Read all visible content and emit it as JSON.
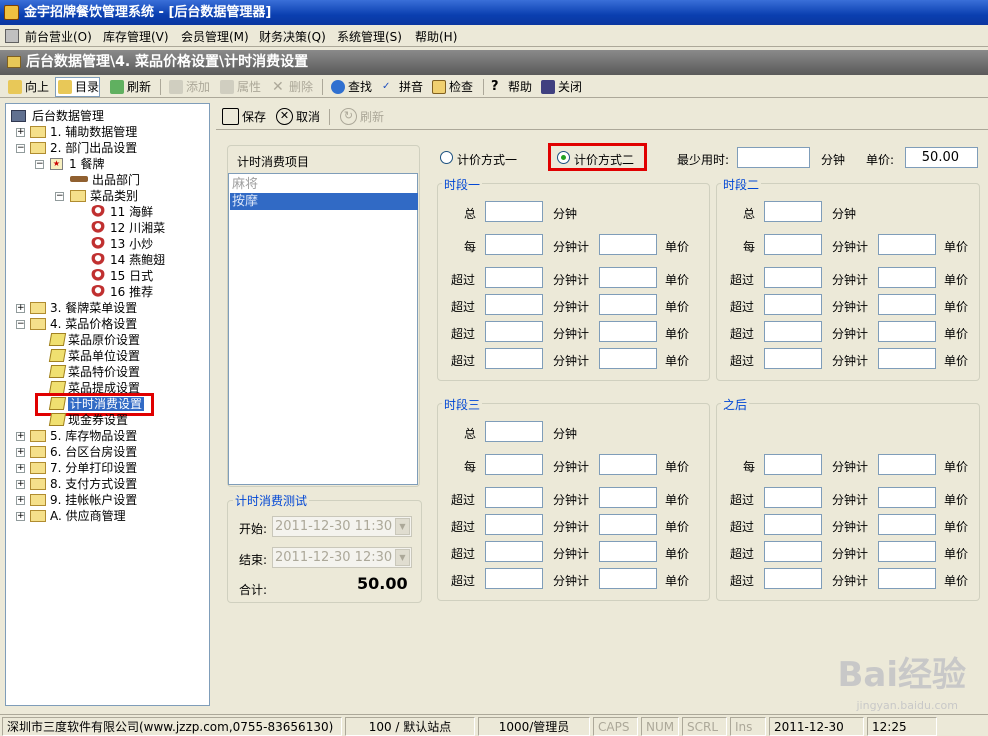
{
  "window": {
    "title": "金宇招牌餐饮管理系统 - [后台数据管理器]"
  },
  "menu": [
    "前台营业(O)",
    "库存管理(V)",
    "会员管理(M)",
    "财务决策(Q)",
    "系统管理(S)",
    "帮助(H)"
  ],
  "path": "后台数据管理\\4. 菜品价格设置\\计时消费设置",
  "toolbar": {
    "up": "向上",
    "dir": "目录",
    "refresh": "刷新",
    "add": "添加",
    "props": "属性",
    "delete": "删除",
    "find": "查找",
    "pinyin": "拼音",
    "check": "检查",
    "help": "帮助",
    "close": "关闭"
  },
  "tree": {
    "root": "后台数据管理",
    "n1": "1. 辅助数据管理",
    "n2": "2. 部门出品设置",
    "n2a": "1 餐牌",
    "n2a1": "出品部门",
    "n2a2": "菜品类别",
    "c11": "11 海鲜",
    "c12": "12 川湘菜",
    "c13": "13 小炒",
    "c14": "14 燕鲍翅",
    "c15": "15 日式",
    "c16": "16 推荐",
    "n3": "3. 餐牌菜单设置",
    "n4": "4. 菜品价格设置",
    "n4a": "菜品原价设置",
    "n4b": "菜品单位设置",
    "n4c": "菜品特价设置",
    "n4d": "菜品提成设置",
    "n4e": "计时消费设置",
    "n4f": "现金券设置",
    "n5": "5. 库存物品设置",
    "n6": "6. 台区台房设置",
    "n7": "7. 分单打印设置",
    "n8": "8. 支付方式设置",
    "n9": "9. 挂帐帐户设置",
    "nA": "A. 供应商管理"
  },
  "rtoolbar": {
    "save": "保存",
    "cancel": "取消",
    "refresh": "刷新"
  },
  "items": {
    "title": "计时消费项目",
    "list": [
      "麻将",
      "按摩"
    ]
  },
  "test": {
    "title": "计时消费测试",
    "start_label": "开始:",
    "start": "2011-12-30 11:30",
    "end_label": "结束:",
    "end": "2011-12-30 12:30",
    "total_label": "合计:",
    "total": "50.00"
  },
  "pricing": {
    "mode1": "计价方式一",
    "mode2": "计价方式二",
    "min_label": "最少用时:",
    "min_unit": "分钟",
    "price_label": "单价:",
    "price": "50.00"
  },
  "periods": {
    "p1": "时段一",
    "p2": "时段二",
    "p3": "时段三",
    "p4": "之后",
    "total": "总",
    "minute": "分钟",
    "each": "每",
    "per_min": "分钟计",
    "unit_price": "单价",
    "over": "超过"
  },
  "status": {
    "company": "深圳市三度软件有限公司(www.jzzp.com,0755-83656130)",
    "station": "100 / 默认站点",
    "user": "1000/管理员",
    "caps": "CAPS",
    "num": "NUM",
    "scrl": "SCRL",
    "ins": "Ins",
    "date": "2011-12-30",
    "time": "12:25"
  },
  "watermark": {
    "brand": "Bai经验",
    "url": "jingyan.baidu.com"
  }
}
